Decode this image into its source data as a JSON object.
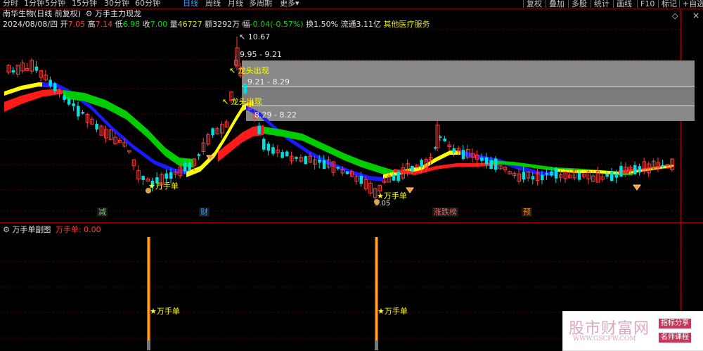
{
  "toolbar": {
    "periods": [
      {
        "label": "分时",
        "active": false
      },
      {
        "label": "1分钟",
        "active": false
      },
      {
        "label": "5分钟",
        "active": false
      },
      {
        "label": "15分钟",
        "active": false
      },
      {
        "label": "30分钟",
        "active": false
      },
      {
        "label": "60分钟",
        "active": false
      },
      {
        "label": "日线",
        "active": true
      },
      {
        "label": "周线",
        "active": false
      },
      {
        "label": "月线",
        "active": false
      },
      {
        "label": "多周期",
        "active": false
      },
      {
        "label": "更多",
        "active": false
      }
    ],
    "more_arrow": "▾",
    "right_buttons": [
      "复权",
      "叠加",
      "多股",
      "统计",
      "画线",
      "F10",
      "标记",
      "+自选"
    ]
  },
  "header": {
    "stock": "南华生物(日线 前复权)",
    "indicator": "万手主力现龙",
    "date": "2024/08/08/四",
    "open_label": "开",
    "open": "7.05",
    "high_label": "高",
    "high": "7.14",
    "low_label": "低",
    "low": "6.98",
    "close_label": "收",
    "close": "7.00",
    "volume_label": "量",
    "volume": "46727",
    "amount_label": "额",
    "amount": "3292万",
    "change_label": "幅",
    "change": "-0.04(-0.57%)",
    "turnover_label": "换",
    "turnover": "1.50%",
    "float_label": "流通",
    "float": "3.11亿",
    "industry": "其他医疗服务"
  },
  "annotations": {
    "max_price": "10.67",
    "zone1_range": "9.95 - 9.21",
    "zone2_range": "9.21 - 8.29",
    "zone3_range": "8.29 - 8.22",
    "dragon1": "龙头出现",
    "dragon2": "龙头出现",
    "signal": "万手单",
    "min_price": "5.05",
    "event_markers": [
      {
        "label": "减",
        "color": "#66cc66"
      },
      {
        "label": "财",
        "color": "#3aa0ff"
      },
      {
        "label": "涨跌榜",
        "color": "#ff5a5a"
      },
      {
        "label": "预",
        "color": "#ff8800"
      }
    ]
  },
  "sub_panel": {
    "title": "万手单副图",
    "value_label": "万手单:",
    "value": "0.00",
    "signal": "万手单"
  },
  "watermark": {
    "main": "股市财富网",
    "url": "WWW.GSCFW.COM",
    "tag1": "指标分享",
    "tag2": "名师课程"
  },
  "colors": {
    "up": "#ff3b3b",
    "down": "#00e0e0",
    "ma_red": "#ff1a1a",
    "ma_yellow": "#ffff00",
    "ma_blue": "#1a1aff",
    "ma_green": "#00cc00",
    "grid": "#5a0000",
    "zone": "#888888",
    "signal": "#ffff00"
  }
}
